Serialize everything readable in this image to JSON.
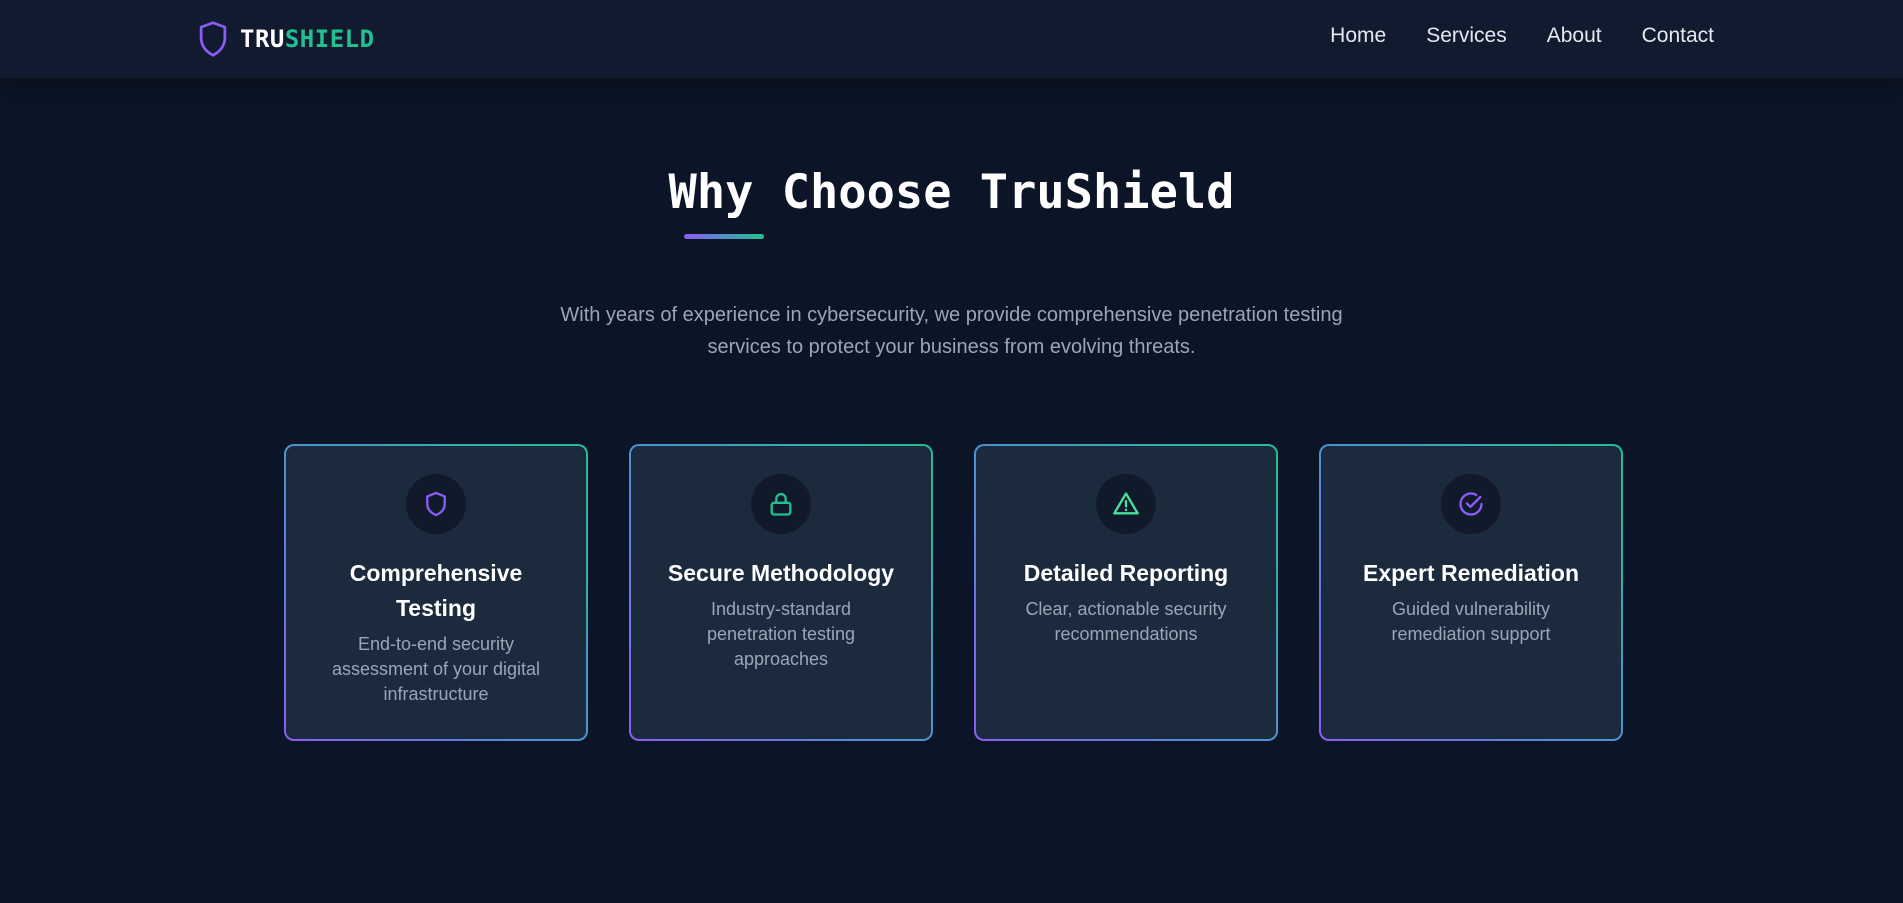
{
  "brand": {
    "name_part1": "TRU",
    "name_part2": "SHIELD",
    "accent_purple": "#8b5cf6",
    "accent_green": "#22c08f"
  },
  "nav": {
    "items": [
      {
        "label": "Home"
      },
      {
        "label": "Services"
      },
      {
        "label": "About"
      },
      {
        "label": "Contact"
      }
    ]
  },
  "section": {
    "title": "Why Choose TruShield",
    "intro": "With years of experience in cybersecurity, we provide comprehensive penetration testing services to protect your business from evolving threats."
  },
  "features": [
    {
      "icon": "shield-icon",
      "title": "Comprehensive Testing",
      "description": "End-to-end security assessment of your digital infrastructure"
    },
    {
      "icon": "lock-icon",
      "title": "Secure Methodology",
      "description": "Industry-standard penetration testing approaches"
    },
    {
      "icon": "warning-icon",
      "title": "Detailed Reporting",
      "description": "Clear, actionable security recommendations"
    },
    {
      "icon": "check-circle-icon",
      "title": "Expert Remediation",
      "description": "Guided vulnerability remediation support"
    }
  ]
}
